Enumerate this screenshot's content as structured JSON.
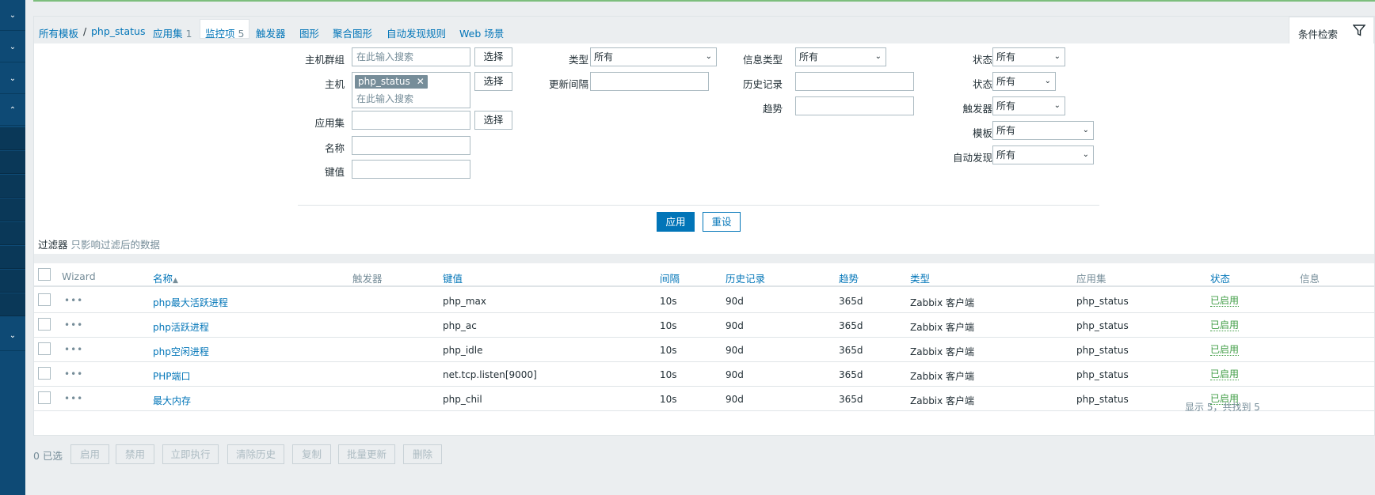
{
  "sidebar": {
    "icons": [
      "chevron-down-icon",
      "chevron-down-icon",
      "chevron-down-icon",
      "chevron-up-icon",
      "chevron-down-icon"
    ]
  },
  "breadcrumb": {
    "all_templates": "所有模板",
    "separator": "/",
    "template": "php_status",
    "tabs": [
      {
        "label": "应用集",
        "count": "1"
      },
      {
        "label": "监控项",
        "count": "5"
      },
      {
        "label": "触发器",
        "count": ""
      },
      {
        "label": "图形",
        "count": ""
      },
      {
        "label": "聚合图形",
        "count": ""
      },
      {
        "label": "自动发现规则",
        "count": ""
      },
      {
        "label": "Web 场景",
        "count": ""
      }
    ]
  },
  "filter_tab": {
    "label": "条件检索",
    "icon": "filter-icon"
  },
  "filter": {
    "host_group_label": "主机群组",
    "host_group_placeholder": "在此输入搜索",
    "select_label": "选择",
    "host_label": "主机",
    "host_chip": "php_status",
    "host_placeholder": "在此输入搜索",
    "appset_label": "应用集",
    "name_label": "名称",
    "key_label": "键值",
    "type_label": "类型",
    "type_value": "所有",
    "interval_label": "更新间隔",
    "info_type_label": "信息类型",
    "info_type_value": "所有",
    "history_label": "历史记录",
    "trends_label": "趋势",
    "state_label": "状态",
    "state_value": "所有",
    "status_label": "状态",
    "status_value": "所有",
    "triggers_label": "触发器",
    "triggers_value": "所有",
    "template_label": "模板",
    "template_value": "所有",
    "discovery_label": "自动发现",
    "discovery_value": "所有",
    "apply": "应用",
    "reset": "重设",
    "note_strong": "过滤器",
    "note_muted": "只影响过滤后的数据"
  },
  "table": {
    "headers": {
      "wizard": "Wizard",
      "name": "名称",
      "name_sort": "▲",
      "triggers": "触发器",
      "key": "键值",
      "interval": "间隔",
      "history": "历史记录",
      "trends": "趋势",
      "type": "类型",
      "appset": "应用集",
      "status": "状态",
      "info": "信息"
    },
    "rows": [
      {
        "name": "php最大活跃进程",
        "key": "php_max",
        "interval": "10s",
        "history": "90d",
        "trends": "365d",
        "type": "Zabbix 客户端",
        "appset": "php_status",
        "status": "已启用"
      },
      {
        "name": "php活跃进程",
        "key": "php_ac",
        "interval": "10s",
        "history": "90d",
        "trends": "365d",
        "type": "Zabbix 客户端",
        "appset": "php_status",
        "status": "已启用"
      },
      {
        "name": "php空闲进程",
        "key": "php_idle",
        "interval": "10s",
        "history": "90d",
        "trends": "365d",
        "type": "Zabbix 客户端",
        "appset": "php_status",
        "status": "已启用"
      },
      {
        "name": "PHP端口",
        "key": "net.tcp.listen[9000]",
        "interval": "10s",
        "history": "90d",
        "trends": "365d",
        "type": "Zabbix 客户端",
        "appset": "php_status",
        "status": "已启用"
      },
      {
        "name": "最大内存",
        "key": "php_chil",
        "interval": "10s",
        "history": "90d",
        "trends": "365d",
        "type": "Zabbix 客户端",
        "appset": "php_status",
        "status": "已启用"
      }
    ],
    "footer": "显示 5，共找到 5",
    "dots": "•••"
  },
  "actions": {
    "selected": "0 已选",
    "buttons": [
      "启用",
      "禁用",
      "立即执行",
      "清除历史",
      "复制",
      "批量更新",
      "删除"
    ]
  }
}
